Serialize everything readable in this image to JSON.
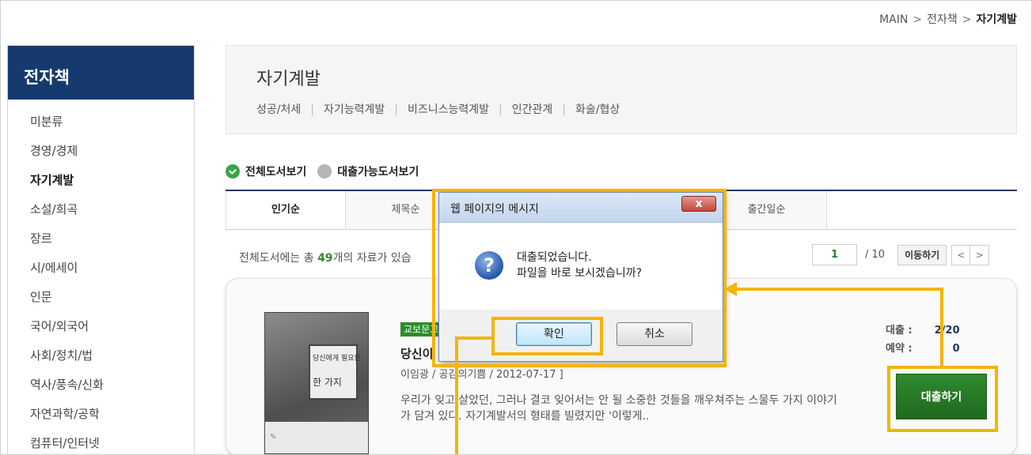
{
  "breadcrumb": {
    "home": "MAIN",
    "level1": "전자책",
    "current": "자기계발",
    "sep": ">"
  },
  "sidebar": {
    "title": "전자책",
    "items": [
      "미분류",
      "경영/경제",
      "자기계발",
      "소설/희곡",
      "장르",
      "시/에세이",
      "인문",
      "국어/외국어",
      "사회/정치/법",
      "역사/풍속/신화",
      "자연과학/공학",
      "컴퓨터/인터넷"
    ],
    "active": "자기계발"
  },
  "category": {
    "title": "자기계발",
    "links": [
      "성공/처세",
      "자기능력계발",
      "비즈니스능력계발",
      "인간관계",
      "화술/협상"
    ]
  },
  "view_options": {
    "all": "전체도서보기",
    "available": "대출가능도서보기"
  },
  "tabs": [
    "인기순",
    "제목순",
    "",
    "",
    "출간일순"
  ],
  "summary": {
    "prefix": "전체도서에는 총 ",
    "count": "49",
    "suffix": "개의 자료가 있습"
  },
  "pager": {
    "current": "1",
    "total": "/ 10",
    "go_label": "이동하기",
    "prev": "<",
    "next": ">"
  },
  "book": {
    "publisher_badge": "교보문고",
    "title": "당신이",
    "meta": "이임광 / 공감의기쁨 / 2012-07-17 ]",
    "description": "우리가 잊고 살았던, 그러나 결코 잊어서는 안 될 소중한 것들을 깨우쳐주는 스물두 가지 이야기가 담겨 있다. 자기계발서의 형태를 빌렸지만 '이렇게..",
    "cover_text_small": "당신에게 필요한",
    "cover_text_big": "한 가지",
    "borrow_label": "대출 :",
    "borrow_value": "2/20",
    "reserve_label": "예약 :",
    "reserve_value": "0",
    "borrow_button": "대출하기"
  },
  "dialog": {
    "title": "웹 페이지의 메시지",
    "close": "x",
    "message_line1": "대출되었습니다.",
    "message_line2": "파일을 바로 보시겠습니까?",
    "ok_label": "확인",
    "cancel_label": "취소",
    "icon": "question-icon"
  },
  "colors": {
    "sidebar_header": "#163a6d",
    "highlight": "#f5b400",
    "accent_green": "#2b8d2b"
  }
}
